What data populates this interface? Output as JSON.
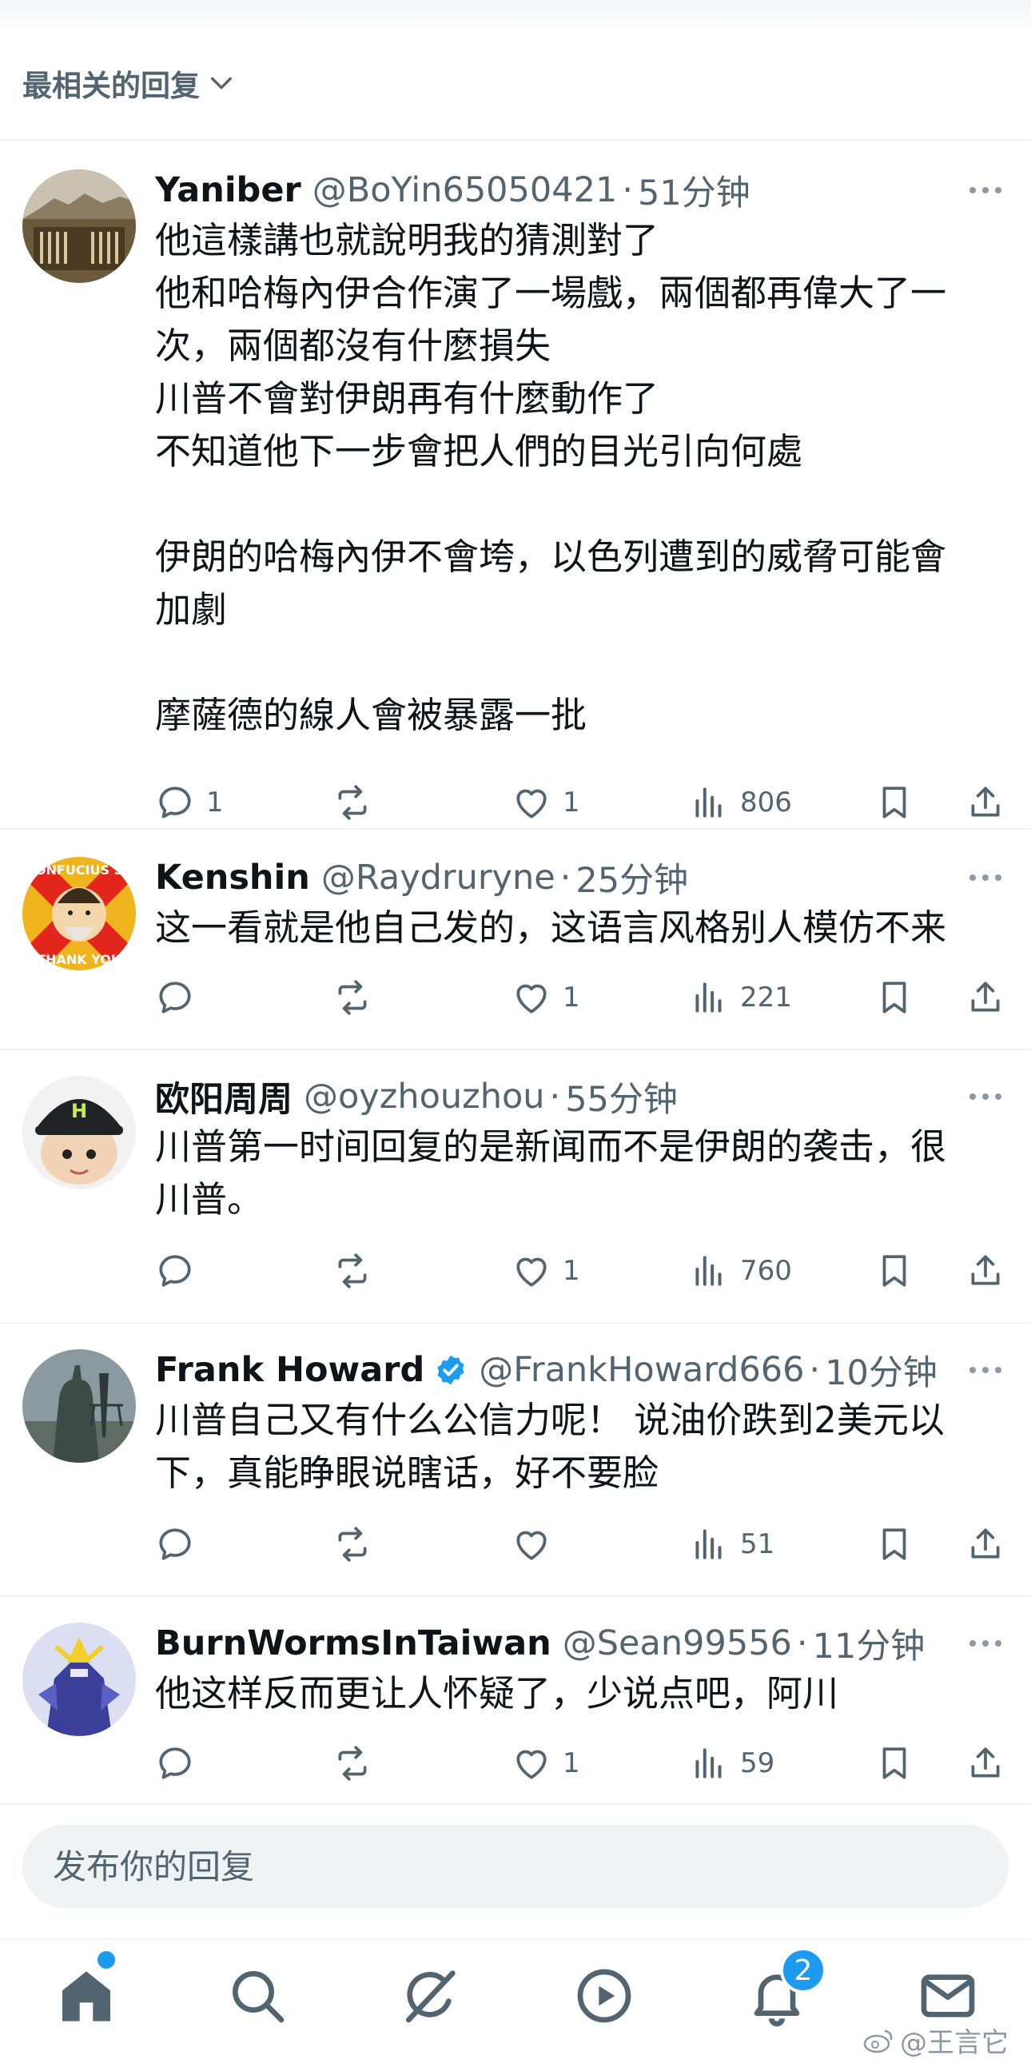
{
  "header": {
    "sort_label": "最相关的回复"
  },
  "replies": [
    {
      "name": "Yaniber",
      "handle": "@BoYin65050421",
      "time": "51分钟",
      "verified": false,
      "lines": [
        "他這樣講也就說明我的猜測對了",
        "他和哈梅內伊合作演了一場戲，兩個都再偉大了一",
        "次，兩個都沒有什麼損失",
        "川普不會對伊朗再有什麼動作了",
        "不知道他下一步會把人們的目光引向何處",
        "",
        "伊朗的哈梅內伊不會垮，以色列遭到的威脅可能會",
        "加劇",
        "",
        "摩薩德的線人會被暴露一批"
      ],
      "replies_count": "1",
      "reposts_count": "",
      "likes_count": "1",
      "views_count": "806"
    },
    {
      "name": "Kenshin",
      "handle": "@Raydruryne",
      "time": "25分钟",
      "verified": false,
      "avatar_text_top": "ONFUCIUS S",
      "avatar_text_bottom": "THANK YOU",
      "lines": [
        "这一看就是他自己发的，这语言风格别人模仿不来"
      ],
      "replies_count": "",
      "reposts_count": "",
      "likes_count": "1",
      "views_count": "221"
    },
    {
      "name": "欧阳周周",
      "handle": "@oyzhouzhou",
      "time": "55分钟",
      "verified": false,
      "avatar_letter": "H",
      "lines": [
        "川普第一时间回复的是新闻而不是伊朗的袭击，很",
        "川普。"
      ],
      "replies_count": "",
      "reposts_count": "",
      "likes_count": "1",
      "views_count": "760"
    },
    {
      "name": "Frank Howard",
      "handle": "@FrankHoward666",
      "time": "10分钟",
      "verified": true,
      "lines": [
        "川普自己又有什么公信力呢！ 说油价跌到2美元以",
        "下，真能睁眼说瞎话，好不要脸"
      ],
      "replies_count": "",
      "reposts_count": "",
      "likes_count": "",
      "views_count": "51"
    },
    {
      "name": "BurnWormsInTaiwan",
      "handle": "@Sean99556",
      "time": "11分钟",
      "verified": false,
      "lines": [
        "他这样反而更让人怀疑了，少说点吧，阿川"
      ],
      "replies_count": "",
      "reposts_count": "",
      "likes_count": "1",
      "views_count": "59"
    }
  ],
  "composer": {
    "placeholder": "发布你的回复"
  },
  "tabbar": {
    "notification_badge": "2"
  },
  "watermark": "@王言它",
  "icons": [
    "chevron-down-icon",
    "more-icon",
    "reply-icon",
    "repost-icon",
    "like-icon",
    "views-icon",
    "bookmark-icon",
    "share-icon",
    "verified-icon",
    "home-icon",
    "search-icon",
    "grok-icon",
    "video-icon",
    "notifications-icon",
    "messages-icon",
    "weibo-icon"
  ],
  "colors": {
    "accent": "#1d9bf0",
    "secondary_text": "#536471",
    "primary_text": "#0f1419",
    "composer_bg": "#eff3f4"
  }
}
